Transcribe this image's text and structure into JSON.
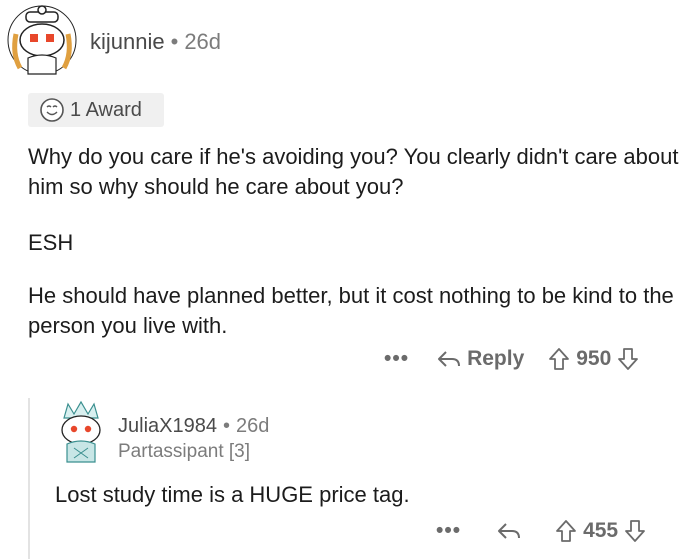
{
  "comment": {
    "username": "kijunnie",
    "separator": "•",
    "age": "26d",
    "award_label": "1 Award",
    "paragraphs": [
      "Why do you care if he's avoiding you? You clearly didn't care about him so why should he care about you?",
      "ESH",
      "He should have planned better, but it cost nothing to be kind to the person you live with."
    ],
    "actions": {
      "more": "•••",
      "reply_label": "Reply",
      "score": "950"
    }
  },
  "reply": {
    "username": "JuliaX1984",
    "separator": "•",
    "age": "26d",
    "flair": "Partassipant [3]",
    "text": "Lost study time is a HUGE price tag.",
    "actions": {
      "more": "•••",
      "score": "455"
    }
  },
  "colors": {
    "text": "#1c1c1c",
    "muted": "#7c7c7c",
    "chip_bg": "#f0f0f0",
    "avatar_red": "#e8472b"
  }
}
